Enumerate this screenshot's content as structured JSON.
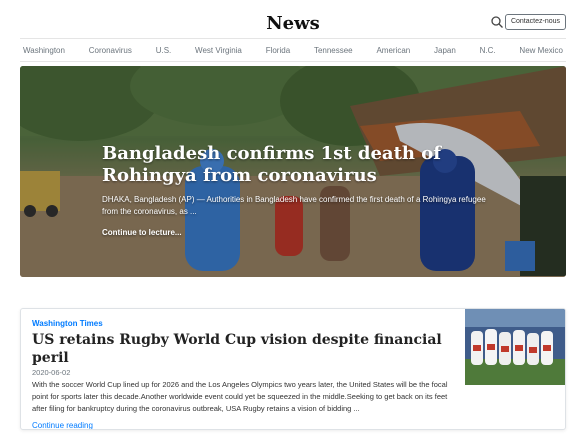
{
  "header": {
    "logo": "News",
    "search_icon": "search-icon",
    "contact_label": "Contactez-nous"
  },
  "nav": {
    "items": [
      "Washington",
      "Coronavirus",
      "U.S.",
      "West Virginia",
      "Florida",
      "Tennessee",
      "American",
      "Japan",
      "N.C.",
      "New Mexico"
    ]
  },
  "hero": {
    "title": "Bangladesh confirms 1st death of Rohingya from coronavirus",
    "lead": "DHAKA, Bangladesh (AP) — Authorities in Bangladesh have confirmed the first death of a Rohingya refugee from the coronavirus, as ...",
    "link": "Continue to lecture..."
  },
  "article": {
    "source": "Washington Times",
    "title": "US retains Rugby World Cup vision despite financial peril",
    "date": "2020-06-02",
    "text": "With the soccer World Cup lined up for 2026 and the Los Angeles Olympics two years later, the United States will be the focal point for sports later this decade.Another worldwide event could yet be squeezed in the middle.Seeking to get back on its feet after filing for bankruptcy during the coronavirus outbreak, USA Rugby retains a vision of bidding ...",
    "link": "Continue reading"
  },
  "colors": {
    "accent": "#007bff",
    "muted": "#6c757d"
  }
}
